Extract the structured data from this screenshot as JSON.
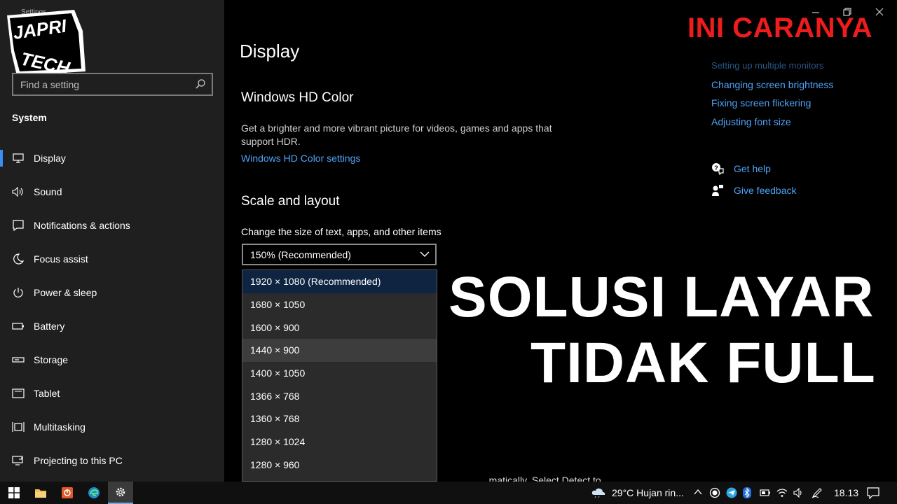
{
  "sidebar": {
    "window_title": "Settings",
    "logo_text": "JAPRI TECH",
    "search_placeholder": "Find a setting",
    "section": "System",
    "items": [
      {
        "label": "Display",
        "icon": "monitor-icon"
      },
      {
        "label": "Sound",
        "icon": "speaker-icon"
      },
      {
        "label": "Notifications & actions",
        "icon": "notification-icon"
      },
      {
        "label": "Focus assist",
        "icon": "moon-icon"
      },
      {
        "label": "Power & sleep",
        "icon": "power-icon"
      },
      {
        "label": "Battery",
        "icon": "battery-icon"
      },
      {
        "label": "Storage",
        "icon": "storage-icon"
      },
      {
        "label": "Tablet",
        "icon": "tablet-icon"
      },
      {
        "label": "Multitasking",
        "icon": "multitasking-icon"
      },
      {
        "label": "Projecting to this PC",
        "icon": "projecting-icon"
      }
    ]
  },
  "main": {
    "title": "Display",
    "hdr_heading": "Windows HD Color",
    "hdr_desc": "Get a brighter and more vibrant picture for videos, games and apps that support HDR.",
    "hdr_link": "Windows HD Color settings",
    "scale_heading": "Scale and layout",
    "scale_label": "Change the size of text, apps, and other items",
    "scale_value": "150% (Recommended)",
    "resolutions": [
      "1920 × 1080 (Recommended)",
      "1680 × 1050",
      "1600 × 900",
      "1440 × 900",
      "1400 × 1050",
      "1366 × 768",
      "1360 × 768",
      "1280 × 1024",
      "1280 × 960"
    ],
    "cut_text": "...matically. Select Detect to"
  },
  "related": {
    "links": [
      "Setting up multiple monitors",
      "Changing screen brightness",
      "Fixing screen flickering",
      "Adjusting font size"
    ],
    "get_help": "Get help",
    "give_feedback": "Give feedback"
  },
  "overlay": {
    "tag": "INI CARANYA",
    "line1": "SOLUSI LAYAR",
    "line2": "TIDAK FULL"
  },
  "taskbar": {
    "weather": "29°C  Hujan rin...",
    "time": "18.13"
  },
  "colors": {
    "accent": "#3a8ff0",
    "link": "#4fa3f7",
    "tag_red": "#ee1c1c"
  }
}
